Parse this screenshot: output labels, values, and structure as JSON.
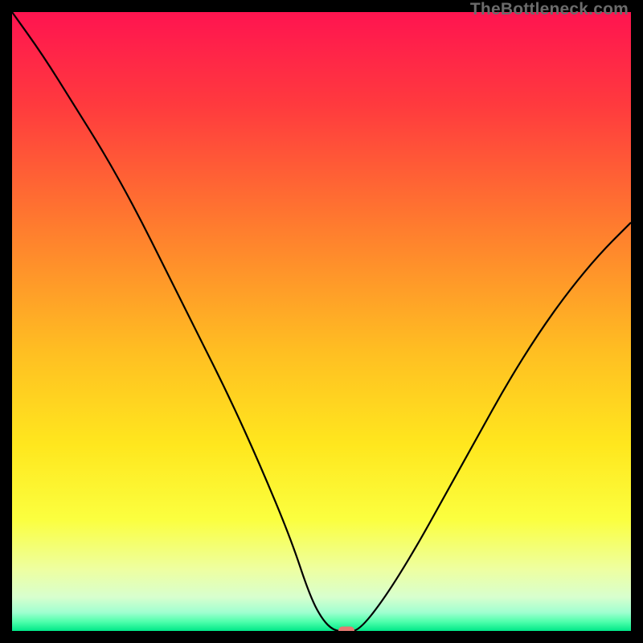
{
  "watermark": "TheBottleneck.com",
  "chart_data": {
    "type": "line",
    "title": "",
    "xlabel": "",
    "ylabel": "",
    "xlim": [
      0,
      100
    ],
    "ylim": [
      0,
      100
    ],
    "x": [
      0,
      5,
      10,
      15,
      20,
      25,
      30,
      35,
      40,
      45,
      48,
      50,
      52,
      54,
      56,
      60,
      65,
      70,
      75,
      80,
      85,
      90,
      95,
      100
    ],
    "values": [
      100,
      93,
      85,
      77,
      68,
      58,
      48,
      38,
      27,
      15,
      6,
      2,
      0,
      0,
      0,
      5,
      13,
      22,
      31,
      40,
      48,
      55,
      61,
      66
    ],
    "marker": {
      "x": 54,
      "y": 0
    },
    "gradient_stops": [
      {
        "offset": 0,
        "color": "#ff1450"
      },
      {
        "offset": 0.15,
        "color": "#ff3a3e"
      },
      {
        "offset": 0.35,
        "color": "#ff7d2e"
      },
      {
        "offset": 0.55,
        "color": "#ffbf22"
      },
      {
        "offset": 0.7,
        "color": "#ffe71e"
      },
      {
        "offset": 0.82,
        "color": "#fbff3f"
      },
      {
        "offset": 0.9,
        "color": "#eeffa0"
      },
      {
        "offset": 0.945,
        "color": "#d8ffce"
      },
      {
        "offset": 0.97,
        "color": "#a0ffd0"
      },
      {
        "offset": 0.985,
        "color": "#4fffac"
      },
      {
        "offset": 1.0,
        "color": "#00e888"
      }
    ]
  }
}
